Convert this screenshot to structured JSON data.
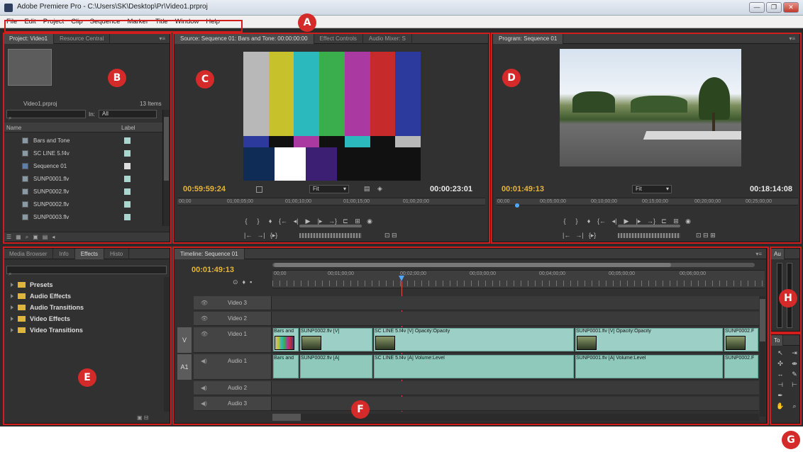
{
  "window": {
    "title": "Adobe Premiere Pro - C:\\Users\\SK\\Desktop\\Pr\\Video1.prproj",
    "minimize": "—",
    "maximize": "❐",
    "close": "✕"
  },
  "menu": [
    "File",
    "Edit",
    "Project",
    "Clip",
    "Sequence",
    "Marker",
    "Title",
    "Window",
    "Help"
  ],
  "markers": [
    "A",
    "B",
    "C",
    "D",
    "E",
    "F",
    "G",
    "H"
  ],
  "project": {
    "tabs": [
      "Project: Video1",
      "Resource Central"
    ],
    "file": "Video1.prproj",
    "count": "13 Items",
    "in_label": "In:",
    "in_value": "All",
    "col_name": "Name",
    "col_label": "Label",
    "items": [
      "Bars and Tone",
      "SC LINE 5.f4v",
      "Sequence 01",
      "SUNP0001.flv",
      "SUNP0002.flv",
      "SUNP0002.flv",
      "SUNP0003.flv"
    ]
  },
  "source": {
    "tabs": [
      "Source: Sequence 01: Bars and Tone: 00:00:00:00",
      "Effect Controls",
      "Audio Mixer: S"
    ],
    "timecode_in": "00:59:59:24",
    "fit": "Fit",
    "timecode_dur": "00:00:23:01",
    "ruler": [
      "00;00",
      "01;00;05;00",
      "01;00;10;00",
      "01;00;15;00",
      "01;00;20;00"
    ]
  },
  "program": {
    "tabs": [
      "Program: Sequence 01"
    ],
    "timecode_in": "00:01:49:13",
    "fit": "Fit",
    "timecode_dur": "00:18:14:08",
    "ruler": [
      "00;00",
      "00;05;00;00",
      "00;10;00;00",
      "00;15;00;00",
      "00;20;00;00",
      "00;25;00;00"
    ]
  },
  "effects": {
    "tabs": [
      "Media Browser",
      "Info",
      "Effects",
      "Histo"
    ],
    "items": [
      "Presets",
      "Audio Effects",
      "Audio Transitions",
      "Video Effects",
      "Video Transitions"
    ]
  },
  "timeline": {
    "tab": "Timeline: Sequence 01",
    "timecode": "00:01:49:13",
    "ruler": [
      "00;00",
      "00;01;00;00",
      "00;02;00;00",
      "00;03;00;00",
      "00;04;00;00",
      "00;05;00;00",
      "00;06;00;00"
    ],
    "tracks": {
      "v3": "Video 3",
      "v2": "Video 2",
      "v1": "Video 1",
      "a1": "Audio 1",
      "a2": "Audio 2",
      "a3": "Audio 3",
      "v_tag": "V",
      "a_tag": "A1"
    },
    "clips": {
      "v_bars": "Bars and",
      "v_sun": "SUNP0002.flv [V]",
      "v_sc": "SC LINE 5.f4v [V]",
      "v_sc_fx": "Opacity:Opacity",
      "v_sun1": "SUNP0001.flv [V]",
      "v_sun1_fx": "Opacity:Opacity",
      "v_sun2": "SUNP0002.F",
      "a_bars": "Bars and",
      "a_sun": "SUNP0002.flv [A]",
      "a_sc": "SC LINE 5.f4v [A]",
      "a_sc_fx": "Volume:Level",
      "a_sun1": "SUNP0001.flv [A]",
      "a_sun1_fx": "Volume:Level",
      "a_sun2": "SUNP0002.F"
    }
  },
  "audio_meter": {
    "tab": "Au"
  },
  "tools": {
    "tab": "To"
  },
  "colors": {
    "accent_red": "#d21d1d",
    "timecode_yellow": "#e6b53a",
    "clip_teal": "#9ccfc5"
  }
}
